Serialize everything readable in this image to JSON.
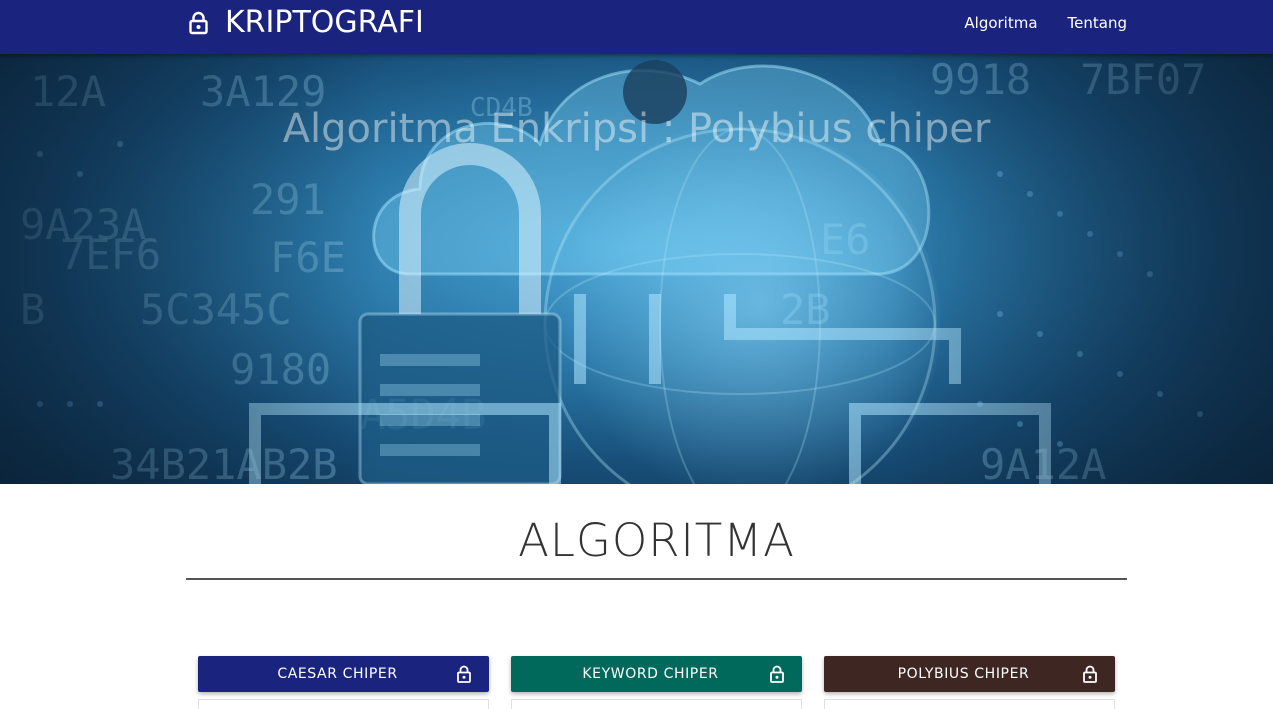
{
  "navbar": {
    "brand": "KRIPTOGRAFI",
    "brand_icon": "lock-icon",
    "links": [
      {
        "label": "Algoritma"
      },
      {
        "label": "Tentang"
      }
    ],
    "bg_color": "#1a237e"
  },
  "hero": {
    "title": "Algoritma Enkripsi : Polybius chiper"
  },
  "section": {
    "title": "ALGORITMA"
  },
  "cards": [
    {
      "label": "CAESAR CHIPER",
      "icon": "lock-icon",
      "color": "#1a237e"
    },
    {
      "label": "KEYWORD CHIPER",
      "icon": "lock-icon",
      "color": "#00695c"
    },
    {
      "label": "POLYBIUS CHIPER",
      "icon": "lock-icon",
      "color": "#3e2723"
    }
  ]
}
